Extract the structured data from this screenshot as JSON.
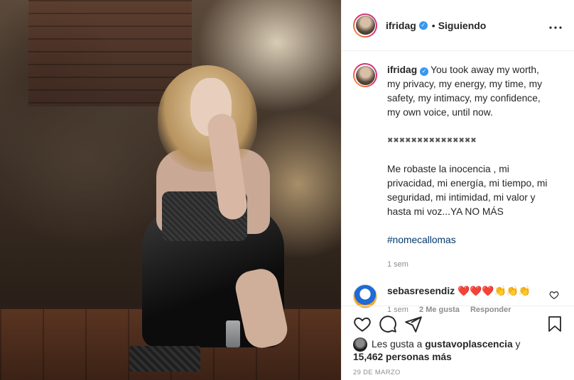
{
  "header": {
    "username": "ifridag",
    "follow_status": "Siguiendo",
    "separator": "•"
  },
  "caption": {
    "username": "ifridag",
    "paragraphs": [
      "You took away my worth, my privacy, my energy, my time, my safety, my intimacy, my confidence, my own voice, until now.",
      "✖✖✖✖✖✖✖✖✖✖✖✖✖✖✖",
      "Me robaste la inocencia , mi privacidad, mi energía, mi tiempo, mi seguridad, mi intimidad, mi valor y hasta mi voz...YA NO MÁS"
    ],
    "hashtag": "#nomecallomas",
    "time": "1 sem"
  },
  "comment": {
    "username": "sebasresendiz",
    "text": "❤️❤️❤️👏👏👏",
    "time": "1 sem",
    "likes": "2 Me gusta",
    "reply": "Responder"
  },
  "likes": {
    "prefix": "Les gusta a",
    "user": "gustavoplascencia",
    "conj": "y",
    "others": "15,462 personas más"
  },
  "date": "29 DE MARZO",
  "icons": {
    "like": "heart-icon",
    "comment": "comment-icon",
    "share": "share-icon",
    "save": "bookmark-icon",
    "more": "more-icon",
    "verified": "verified-icon"
  },
  "colors": {
    "accent_blue": "#3897f0",
    "hashtag": "#00376b",
    "heart_red": "#ed4956"
  }
}
